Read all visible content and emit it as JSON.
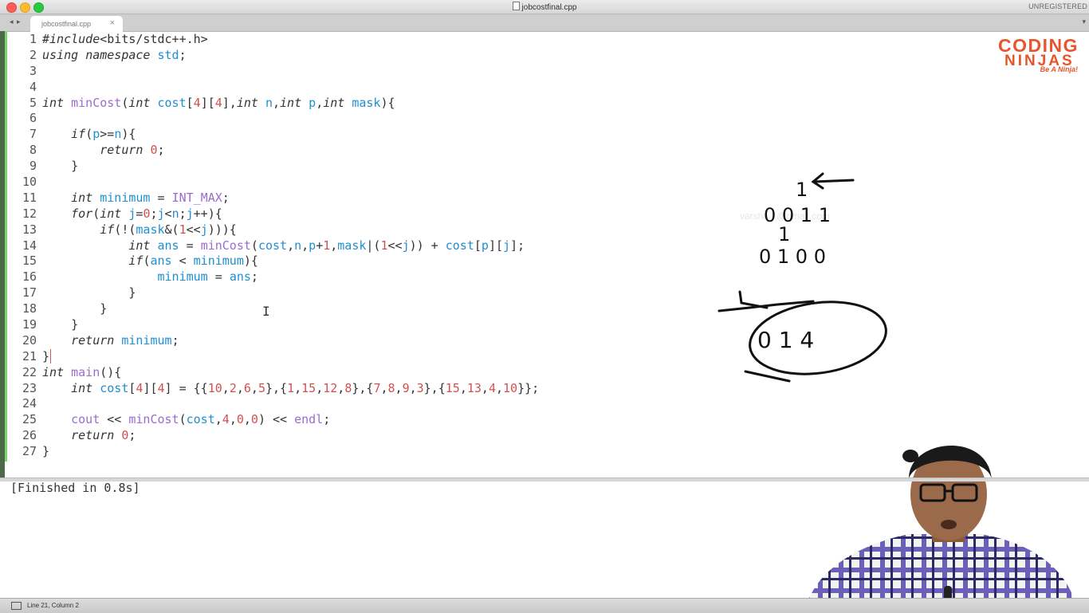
{
  "window": {
    "title": "jobcostfinal.cpp",
    "license_notice": "UNREGISTERED"
  },
  "tabs": [
    {
      "label": "jobcostfinal.cpp",
      "close_glyph": "×"
    }
  ],
  "tabbar": {
    "nav_arrows": "◂ ▸",
    "dropdown_glyph": "▾"
  },
  "editor": {
    "line_numbers": [
      "1",
      "2",
      "3",
      "4",
      "5",
      "6",
      "7",
      "8",
      "9",
      "10",
      "11",
      "12",
      "13",
      "14",
      "15",
      "16",
      "17",
      "18",
      "19",
      "20",
      "21",
      "22",
      "23",
      "24",
      "25",
      "26",
      "27"
    ],
    "lines": [
      "#include<bits/stdc++.h>",
      "using namespace std;",
      "",
      "",
      "int minCost(int cost[4][4],int n,int p,int mask){",
      "",
      "    if(p>=n){",
      "        return 0;",
      "    }",
      "",
      "    int minimum = INT_MAX;",
      "    for(int j=0;j<n;j++){",
      "        if(!(mask&(1<<j))){",
      "            int ans = minCost(cost,n,p+1,mask|(1<<j)) + cost[p][j];",
      "            if(ans < minimum){",
      "                minimum = ans;",
      "            }",
      "        }",
      "    }",
      "    return minimum;",
      "}",
      "int main(){",
      "    int cost[4][4] = {{10,2,6,5},{1,15,12,8},{7,8,9,3},{15,13,4,10}};",
      "",
      "    cout << minCost(cost,4,0,0) << endl;",
      "    return 0;",
      "}"
    ]
  },
  "output_panel": {
    "text": "[Finished in 0.8s]"
  },
  "status_bar": {
    "position": "Line 21, Column 2"
  },
  "logo": {
    "line1": "CODING",
    "line2": "NINJAS",
    "tagline": "Be A Ninja!"
  },
  "watermark": {
    "text": "varsha...@gmail.com"
  },
  "sketch": {
    "row1": "1",
    "row2": "0 0 1 1",
    "row3": "1",
    "row4": "0 1 0 0",
    "circled": "0 1 4"
  },
  "colors": {
    "keyword": "#333333",
    "function": "#9c6bd0",
    "number": "#d45050",
    "variable": "#1f8fd0",
    "gutter_marker": "#7bd66a",
    "brand": "#e8552d"
  }
}
